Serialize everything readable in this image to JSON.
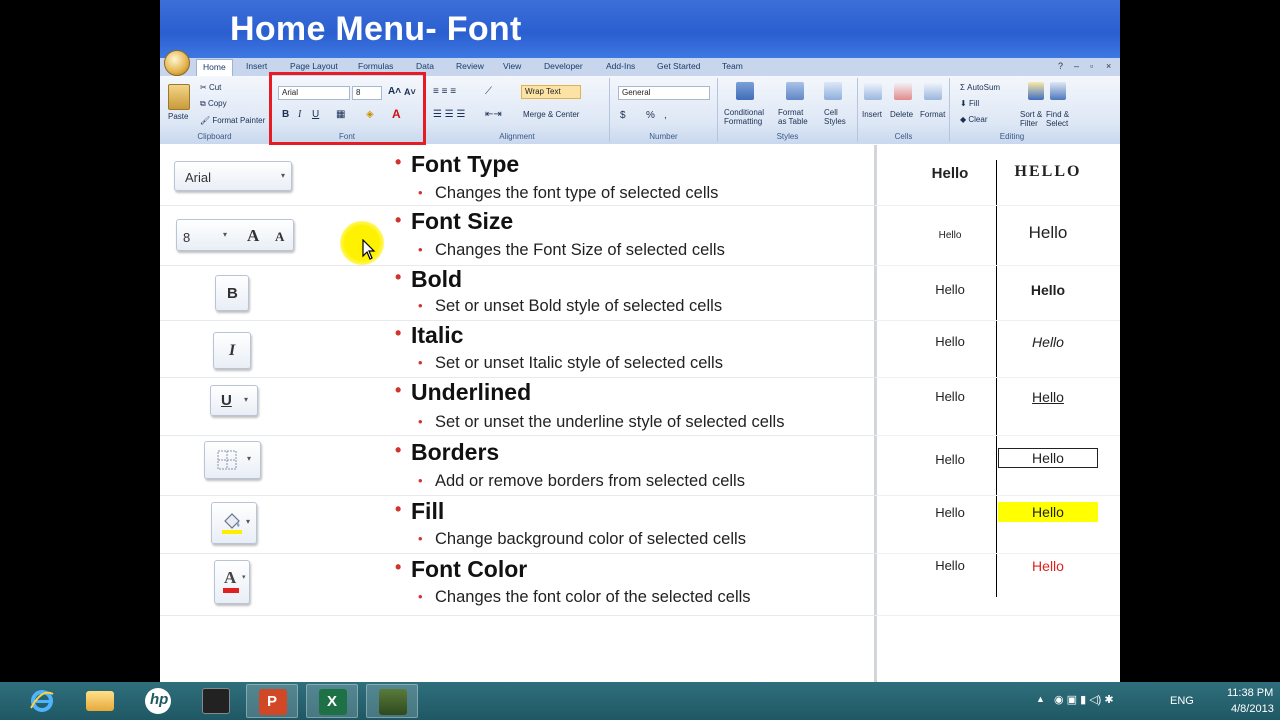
{
  "slide": {
    "title": "Home Menu- Font"
  },
  "ribbon": {
    "tabs": [
      "Home",
      "Insert",
      "Page Layout",
      "Formulas",
      "Data",
      "Review",
      "View",
      "Developer",
      "Add-Ins",
      "Get Started",
      "Team"
    ],
    "clipboard": {
      "paste": "Paste",
      "cut": "Cut",
      "copy": "Copy",
      "format_painter": "Format Painter",
      "label": "Clipboard"
    },
    "font": {
      "font_name": "Arial",
      "font_size": "8",
      "label": "Font"
    },
    "alignment": {
      "wrap_text": "Wrap Text",
      "merge_center": "Merge & Center",
      "label": "Alignment"
    },
    "number": {
      "format": "General",
      "dollar": "$",
      "percent": "%",
      "comma": ",",
      "label": "Number"
    },
    "styles": {
      "conditional": "Conditional",
      "formatting": "Formatting",
      "format_as": "Format",
      "as_table": "as Table",
      "cell": "Cell",
      "cell_styles": "Styles",
      "label": "Styles"
    },
    "cells": {
      "insert": "Insert",
      "delete": "Delete",
      "format": "Format",
      "label": "Cells"
    },
    "editing": {
      "autosum": "AutoSum",
      "fill": "Fill",
      "clear": "Clear",
      "sort": "Sort &",
      "filter": "Filter",
      "find": "Find &",
      "select": "Select",
      "label": "Editing"
    }
  },
  "features": [
    {
      "title": "Font Type",
      "desc": "Changes  the font type of selected cells",
      "icon_text": "Arial",
      "example_left": "Hello",
      "example_right": "HELLO"
    },
    {
      "title": "Font Size",
      "desc": "Changes  the Font Size of selected cells",
      "icon_text": "8",
      "example_left": "Hello",
      "example_right": "Hello"
    },
    {
      "title": "Bold",
      "desc": "Set or unset Bold style of selected cells",
      "icon_text": "B",
      "example_left": "Hello",
      "example_right": "Hello"
    },
    {
      "title": "Italic",
      "desc": "Set or unset Italic style of selected cells",
      "icon_text": "I",
      "example_left": "Hello",
      "example_right": "Hello"
    },
    {
      "title": "Underlined",
      "desc": "Set or unset the underline  style of selected cells",
      "icon_text": "U",
      "example_left": "Hello",
      "example_right": "Hello"
    },
    {
      "title": "Borders",
      "desc": "Add or remove borders from selected cells",
      "icon_text": "",
      "example_left": "Hello",
      "example_right": "Hello"
    },
    {
      "title": "Fill",
      "desc": "Change  background color of selected cells",
      "icon_text": "",
      "example_left": "Hello",
      "example_right": "Hello"
    },
    {
      "title": "Font Color",
      "desc": "Changes  the font color of the selected cells",
      "icon_text": "A",
      "example_left": "Hello",
      "example_right": "Hello"
    }
  ],
  "colors": {
    "title_bar": "#2b5fd0",
    "bullet": "#d0342c",
    "highlight_yellow": "#ffff00",
    "font_color_red": "#e02020",
    "taskbar": "#1f5864"
  },
  "taskbar": {
    "apps": [
      "internet-explorer-icon",
      "file-explorer-icon",
      "hp-icon",
      "media-icon",
      "powerpoint-icon",
      "excel-icon",
      "app-icon"
    ],
    "language": "ENG",
    "time": "11:38 PM",
    "date": "4/8/2013"
  }
}
